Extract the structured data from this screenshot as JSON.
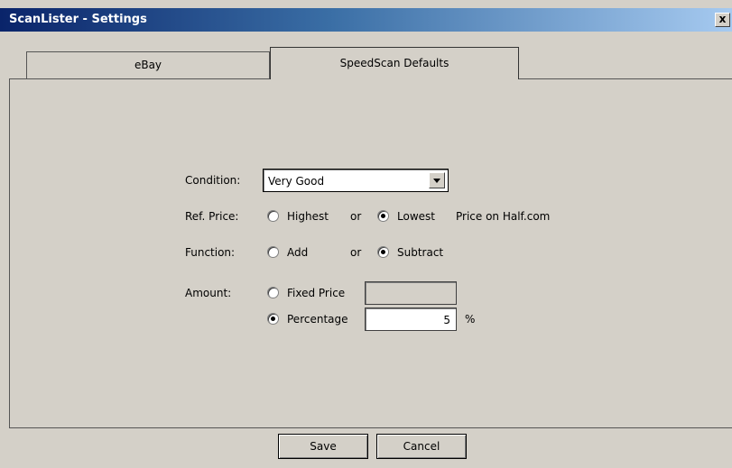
{
  "window": {
    "title": "ScanLister - Settings",
    "close_label": "x"
  },
  "tabs": [
    {
      "label": "eBay"
    },
    {
      "label": "SpeedScan Defaults"
    }
  ],
  "form": {
    "condition": {
      "label": "Condition:",
      "value": "Very Good"
    },
    "ref_price": {
      "label": "Ref. Price:",
      "option_highest": "Highest",
      "or": "or",
      "option_lowest": "Lowest",
      "suffix": "Price on Half.com",
      "selected": "Lowest"
    },
    "function": {
      "label": "Function:",
      "option_add": "Add",
      "or": "or",
      "option_subtract": "Subtract",
      "selected": "Subtract"
    },
    "amount": {
      "label": "Amount:",
      "option_fixed": "Fixed Price",
      "fixed_value": "",
      "option_percentage": "Percentage",
      "percentage_value": "5",
      "percent_sign": "%",
      "selected": "Percentage"
    }
  },
  "buttons": {
    "save": "Save",
    "cancel": "Cancel"
  }
}
